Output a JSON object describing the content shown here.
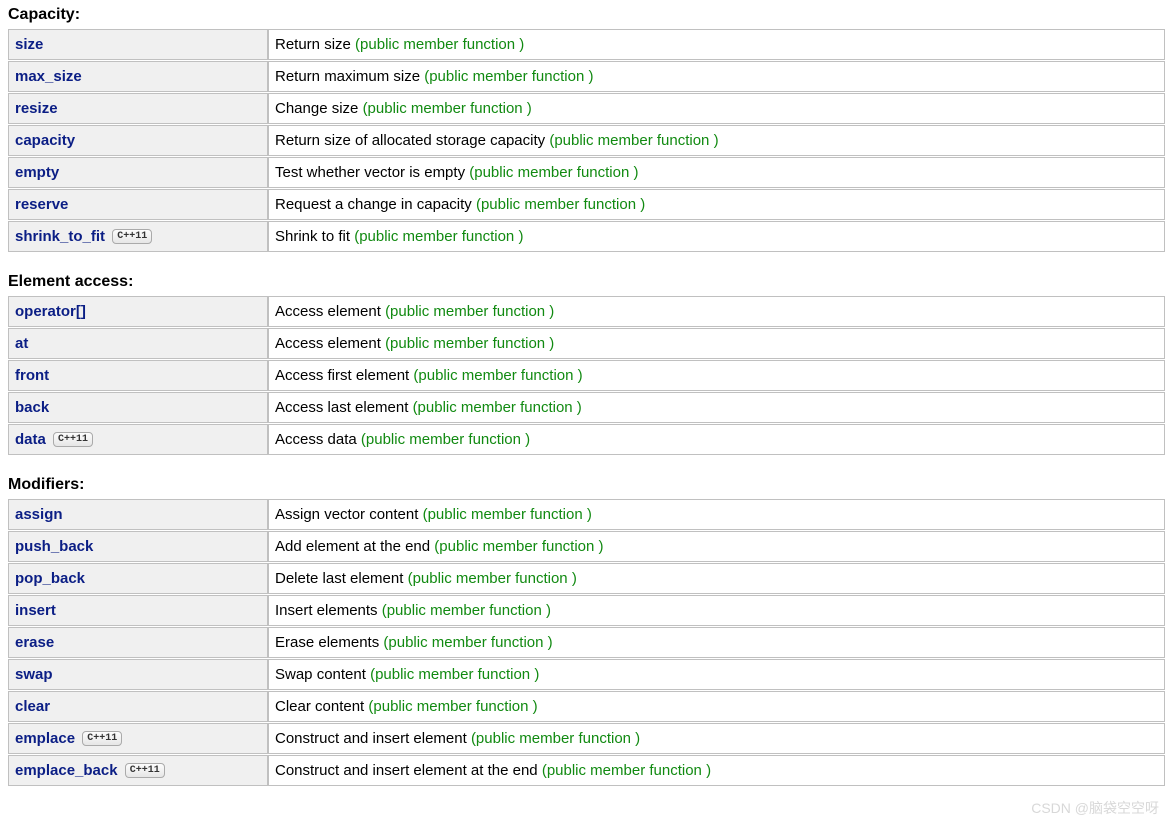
{
  "note_text": "(public member function )",
  "badge_text": "C++11",
  "sections": [
    {
      "title": "Capacity:",
      "rows": [
        {
          "name": "size",
          "desc": "Return size",
          "badge": false
        },
        {
          "name": "max_size",
          "desc": "Return maximum size",
          "badge": false
        },
        {
          "name": "resize",
          "desc": "Change size",
          "badge": false
        },
        {
          "name": "capacity",
          "desc": "Return size of allocated storage capacity",
          "badge": false
        },
        {
          "name": "empty",
          "desc": "Test whether vector is empty",
          "badge": false
        },
        {
          "name": "reserve",
          "desc": "Request a change in capacity",
          "badge": false
        },
        {
          "name": "shrink_to_fit",
          "desc": "Shrink to fit",
          "badge": true
        }
      ]
    },
    {
      "title": "Element access:",
      "rows": [
        {
          "name": "operator[]",
          "desc": "Access element",
          "badge": false
        },
        {
          "name": "at",
          "desc": "Access element",
          "badge": false
        },
        {
          "name": "front",
          "desc": "Access first element",
          "badge": false
        },
        {
          "name": "back",
          "desc": "Access last element",
          "badge": false
        },
        {
          "name": "data",
          "desc": "Access data",
          "badge": true
        }
      ]
    },
    {
      "title": "Modifiers:",
      "rows": [
        {
          "name": "assign",
          "desc": "Assign vector content",
          "badge": false
        },
        {
          "name": "push_back",
          "desc": "Add element at the end",
          "badge": false
        },
        {
          "name": "pop_back",
          "desc": "Delete last element",
          "badge": false
        },
        {
          "name": "insert",
          "desc": "Insert elements",
          "badge": false
        },
        {
          "name": "erase",
          "desc": "Erase elements",
          "badge": false
        },
        {
          "name": "swap",
          "desc": "Swap content",
          "badge": false
        },
        {
          "name": "clear",
          "desc": "Clear content",
          "badge": false
        },
        {
          "name": "emplace",
          "desc": "Construct and insert element",
          "badge": true
        },
        {
          "name": "emplace_back",
          "desc": "Construct and insert element at the end",
          "badge": true
        }
      ]
    }
  ],
  "watermark": "CSDN @脑袋空空呀"
}
